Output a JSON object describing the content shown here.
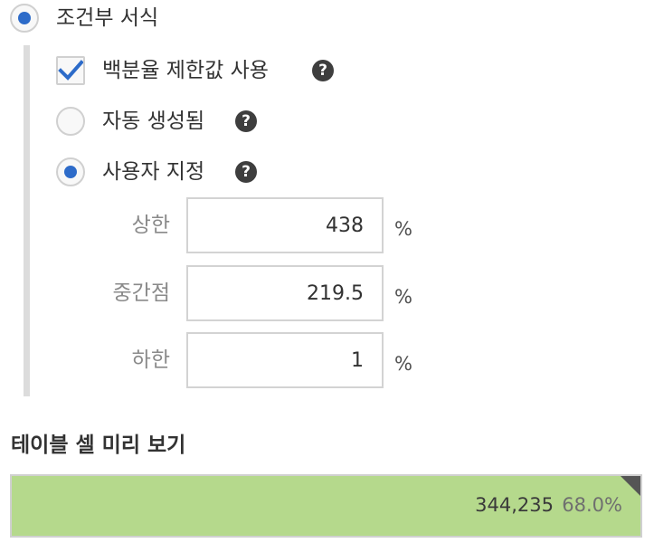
{
  "conditional_formatting": {
    "label": "조건부 서식",
    "selected": true
  },
  "percent_limits": {
    "label": "백분율 제한값 사용",
    "checked": true,
    "help_icon": "question-circle-icon"
  },
  "options": {
    "auto_generated": {
      "label": "자동 생성됨",
      "selected": false
    },
    "custom": {
      "label": "사용자 지정",
      "selected": true
    }
  },
  "fields": {
    "upper": {
      "label": "상한",
      "value": "438",
      "unit": "%"
    },
    "midpoint": {
      "label": "중간점",
      "value": "219.5",
      "unit": "%"
    },
    "lower": {
      "label": "하한",
      "value": "1",
      "unit": "%"
    }
  },
  "preview": {
    "title": "테이블 셀 미리 보기",
    "value": "344,235",
    "percent": "68.0%",
    "fill_color": "#b5d98c"
  },
  "colors": {
    "accent": "#2d6bc9"
  }
}
